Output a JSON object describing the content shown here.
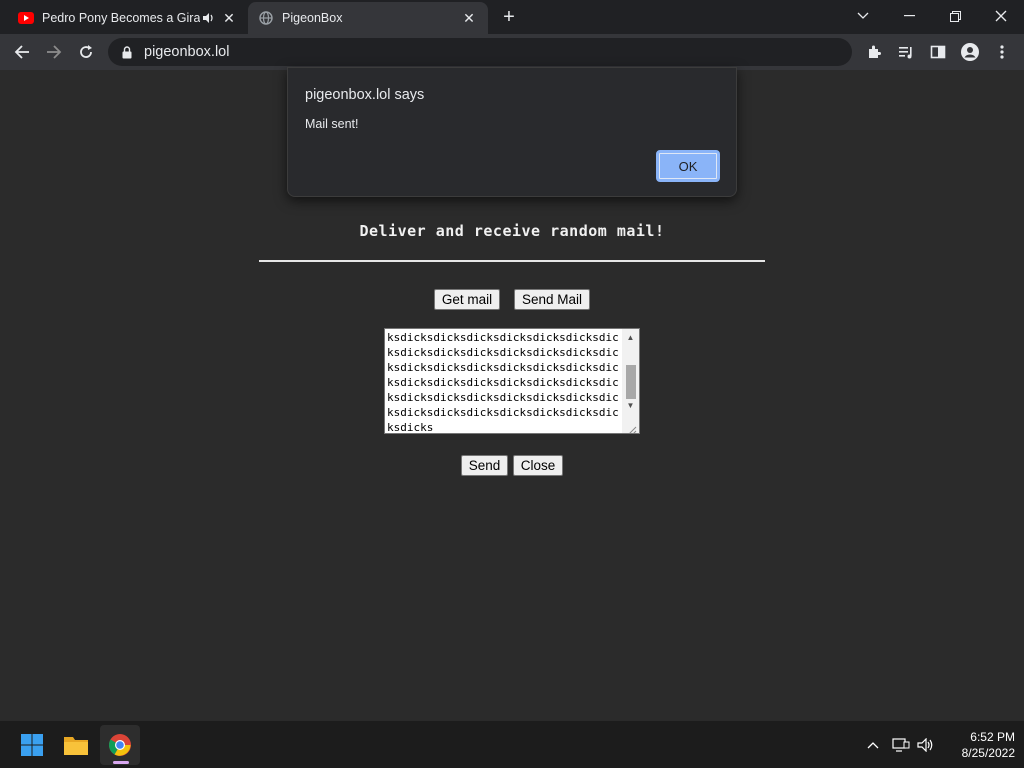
{
  "browser": {
    "tabs": [
      {
        "title": "Pedro Pony Becomes a Giraffe",
        "favicon": "youtube-icon",
        "audio": true
      },
      {
        "title": "PigeonBox",
        "favicon": "globe-icon",
        "active": true
      }
    ],
    "address": "pigeonbox.lol"
  },
  "page": {
    "tagline": "Deliver and receive random mail!",
    "buttons": {
      "get_mail": "Get mail",
      "send_mail": "Send Mail",
      "send": "Send",
      "close": "Close"
    },
    "mail_text": "ksdicksdicksdicksdicksdicksdicksdicksdicksdicksdicksdicksdicksdicksdicksdicksdicksdicksdicksdicksdicksdicksdicksdicksdicksdicksdicksdicksdicksdicksdicksdicksdicksdicksdicksdicksdicksdicksdicksdicksdicksdicksdicksdicks"
  },
  "dialog": {
    "title": "pigeonbox.lol says",
    "message": "Mail sent!",
    "ok_label": "OK"
  },
  "taskbar": {
    "time": "6:52 PM",
    "date": "8/25/2022"
  },
  "colors": {
    "page_bg": "#2b2b2b",
    "dialog_ok": "#8ab4f8",
    "youtube_red": "#ff0000"
  }
}
